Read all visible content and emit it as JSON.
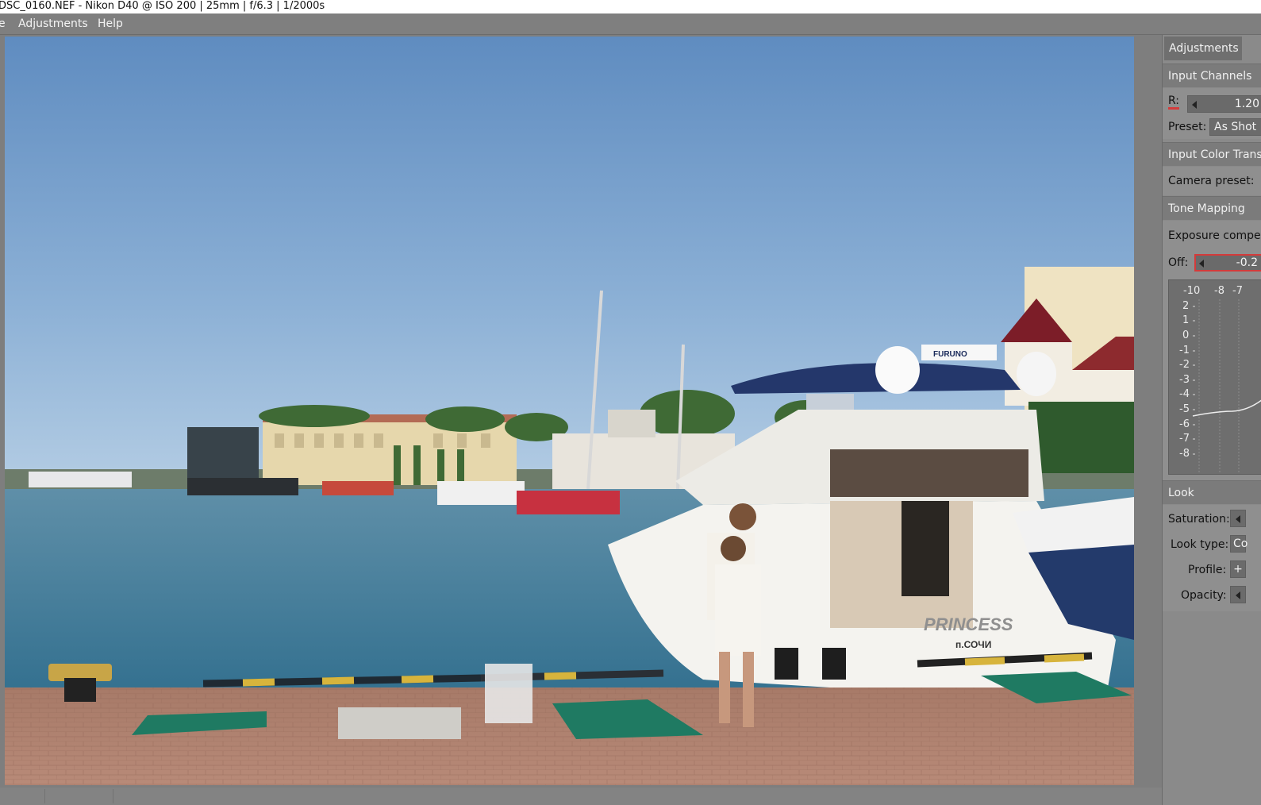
{
  "window": {
    "title": "DSC_0160.NEF  -  Nikon D40  @  ISO 200  |  25mm  |  f/6.3  |  1/2000s"
  },
  "menu": {
    "items": [
      "e",
      "Adjustments",
      "Help"
    ]
  },
  "photo": {
    "alt": "Harbor scene with white yacht PRINCESS and two people on the pier",
    "boat_name": "PRINCESS",
    "boat_port": "п.СОЧИ",
    "radar_label": "FURUNO"
  },
  "dock": {
    "tab_label": "Adjustments",
    "input_channels": {
      "header": "Input Channels",
      "r_label": "R:",
      "r_value": "1.20",
      "preset_label": "Preset:",
      "preset_value": "As Shot"
    },
    "input_color": {
      "header": "Input Color Transform",
      "camera_preset_label": "Camera preset:"
    },
    "tone_mapping": {
      "header": "Tone Mapping",
      "exposure_label": "Exposure compensation",
      "off_label": "Off:",
      "exposure_value": "-0.2",
      "graph_x_labels": [
        "-10",
        "-8",
        "-7"
      ],
      "graph_y_labels": [
        "2",
        "1",
        "0",
        "-1",
        "-2",
        "-3",
        "-4",
        "-5",
        "-6",
        "-7",
        "-8"
      ]
    },
    "look": {
      "header": "Look",
      "saturation_label": "Saturation:",
      "look_type_label": "Look type:",
      "look_type_value": "Co",
      "profile_label": "Profile:",
      "profile_button": "+",
      "opacity_label": "Opacity:"
    }
  },
  "colors": {
    "highlight_red": "#d43b3b",
    "panel_dark": "#6b6b6b",
    "background": "#7e7e7e"
  }
}
